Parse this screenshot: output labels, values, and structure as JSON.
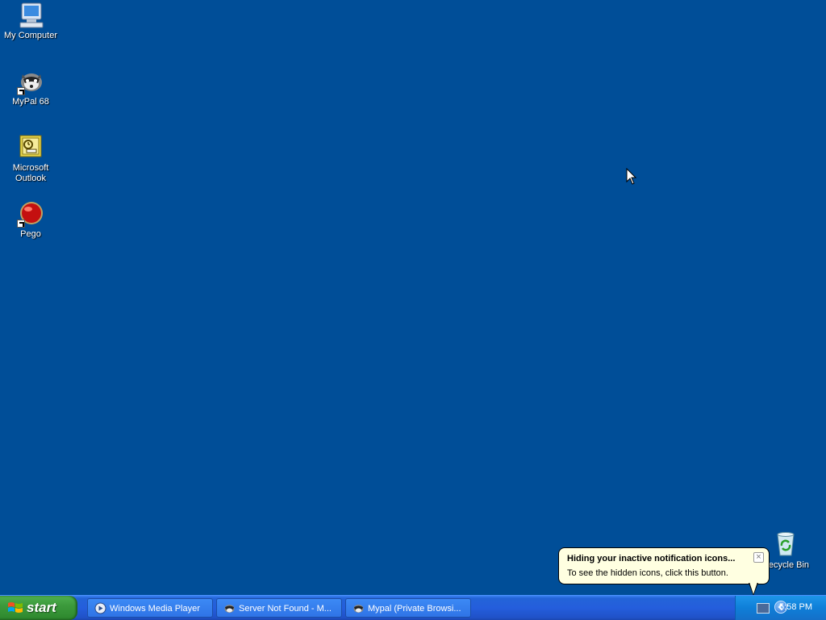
{
  "desktop": {
    "icons": [
      {
        "label": "My Computer",
        "icon": "my-computer-icon"
      },
      {
        "label": "MyPal 68",
        "icon": "raccoon-icon"
      },
      {
        "label": "Microsoft Outlook",
        "icon": "outlook-icon"
      },
      {
        "label": "Pego",
        "icon": "red-orb-icon"
      },
      {
        "label": "Recycle Bin",
        "icon": "recycle-bin-icon"
      }
    ],
    "background_color": "#004e98"
  },
  "taskbar": {
    "start_label": "start",
    "buttons": [
      {
        "label": "Windows Media Player",
        "icon": "media-player-icon"
      },
      {
        "label": "Server Not Found - M...",
        "icon": "raccoon-icon"
      },
      {
        "label": "Mypal (Private Browsi...",
        "icon": "raccoon-icon"
      }
    ],
    "tray": {
      "clock": "5:58 PM"
    }
  },
  "balloon": {
    "title": "Hiding your inactive notification icons...",
    "text": "To see the hidden icons, click this button."
  }
}
